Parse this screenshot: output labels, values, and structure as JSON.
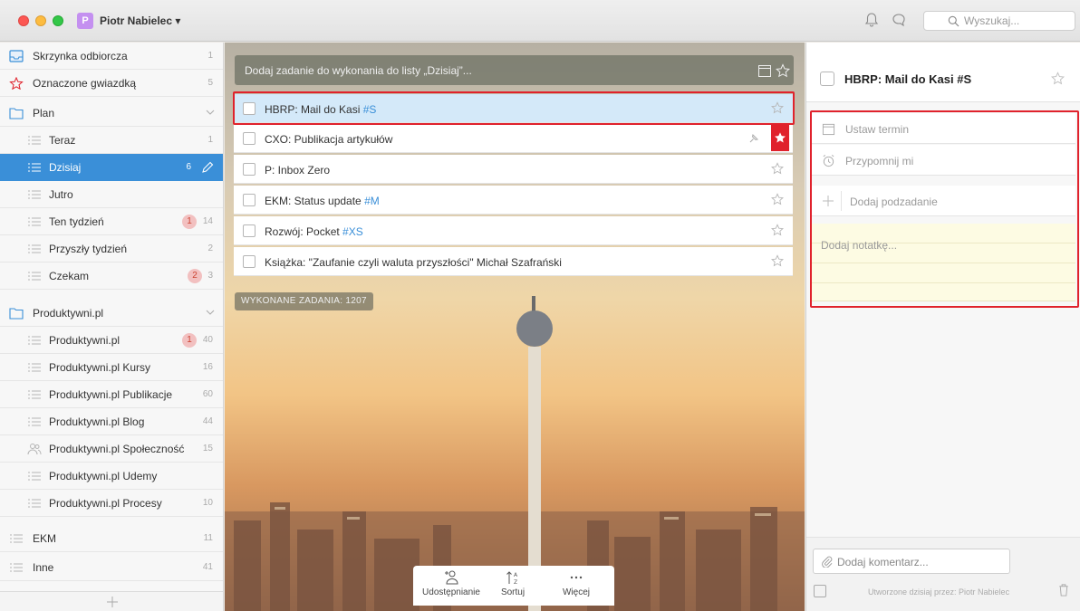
{
  "titlebar": {
    "user_initial": "P",
    "user_name": "Piotr Nabielec ▾",
    "search_placeholder": "Wyszukaj..."
  },
  "sidebar": {
    "items": [
      {
        "label": "Skrzynka odbiorcza",
        "count": "1"
      },
      {
        "label": "Oznaczone gwiazdką",
        "count": "5"
      },
      {
        "label": "Plan"
      },
      {
        "label": "Teraz",
        "count": "1"
      },
      {
        "label": "Dzisiaj",
        "count": "6"
      },
      {
        "label": "Jutro"
      },
      {
        "label": "Ten tydzień",
        "badge": "1",
        "count": "14"
      },
      {
        "label": "Przyszły tydzień",
        "count": "2"
      },
      {
        "label": "Czekam",
        "badge": "2",
        "count": "3"
      },
      {
        "label": "Produktywni.pl"
      },
      {
        "label": "Produktywni.pl",
        "badge": "1",
        "count": "40"
      },
      {
        "label": "Produktywni.pl Kursy",
        "count": "16"
      },
      {
        "label": "Produktywni.pl Publikacje",
        "count": "60"
      },
      {
        "label": "Produktywni.pl Blog",
        "count": "44"
      },
      {
        "label": "Produktywni.pl Społeczność",
        "count": "15"
      },
      {
        "label": "Produktywni.pl Udemy"
      },
      {
        "label": "Produktywni.pl Procesy",
        "count": "10"
      },
      {
        "label": "EKM",
        "count": "11"
      },
      {
        "label": "Inne",
        "count": "41"
      }
    ]
  },
  "main": {
    "add_placeholder": "Dodaj zadanie do wykonania do listy „Dzisiaj”...",
    "tasks": [
      {
        "title": "HBRP: Mail do Kasi",
        "tag": "#S"
      },
      {
        "title": "CXO: Publikacja artykułów",
        "tag": ""
      },
      {
        "title": "P: Inbox Zero",
        "tag": ""
      },
      {
        "title": "EKM: Status update",
        "tag": "#M"
      },
      {
        "title": "Rozwój: Pocket",
        "tag": "#XS"
      },
      {
        "title": "Książka: \"Zaufanie czyli waluta przyszłości\" Michał Szafrański",
        "tag": ""
      }
    ],
    "completed_label": "WYKONANE ZADANIA: 1207",
    "toolbar": {
      "share": "Udostępnianie",
      "sort": "Sortuj",
      "more": "Więcej"
    }
  },
  "detail": {
    "title": "HBRP: Mail do Kasi #S",
    "due": "Ustaw termin",
    "reminder": "Przypomnij mi",
    "subtask": "Dodaj podzadanie",
    "note": "Dodaj notatkę...",
    "comment": "Dodaj komentarz...",
    "created": "Utworzone dzisiaj przez: Piotr Nabielec"
  },
  "colors": {
    "accent": "#3a8fd8",
    "highlight": "#e0222c",
    "star_flag": "#e0222c"
  }
}
